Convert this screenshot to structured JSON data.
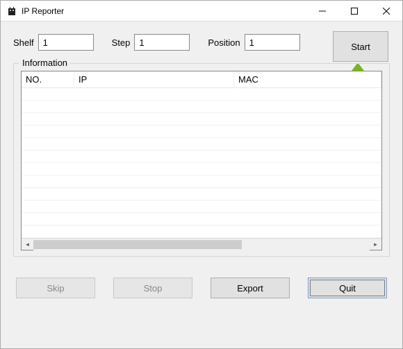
{
  "window": {
    "title": "IP Reporter"
  },
  "inputs": {
    "shelf_label": "Shelf",
    "shelf_value": "1",
    "step_label": "Step",
    "step_value": "1",
    "position_label": "Position",
    "position_value": "1"
  },
  "buttons": {
    "start": "Start",
    "skip": "Skip",
    "stop": "Stop",
    "export": "Export",
    "quit": "Quit"
  },
  "group": {
    "legend": "Information"
  },
  "grid": {
    "columns": [
      "NO.",
      "IP",
      "MAC"
    ],
    "rows": []
  }
}
